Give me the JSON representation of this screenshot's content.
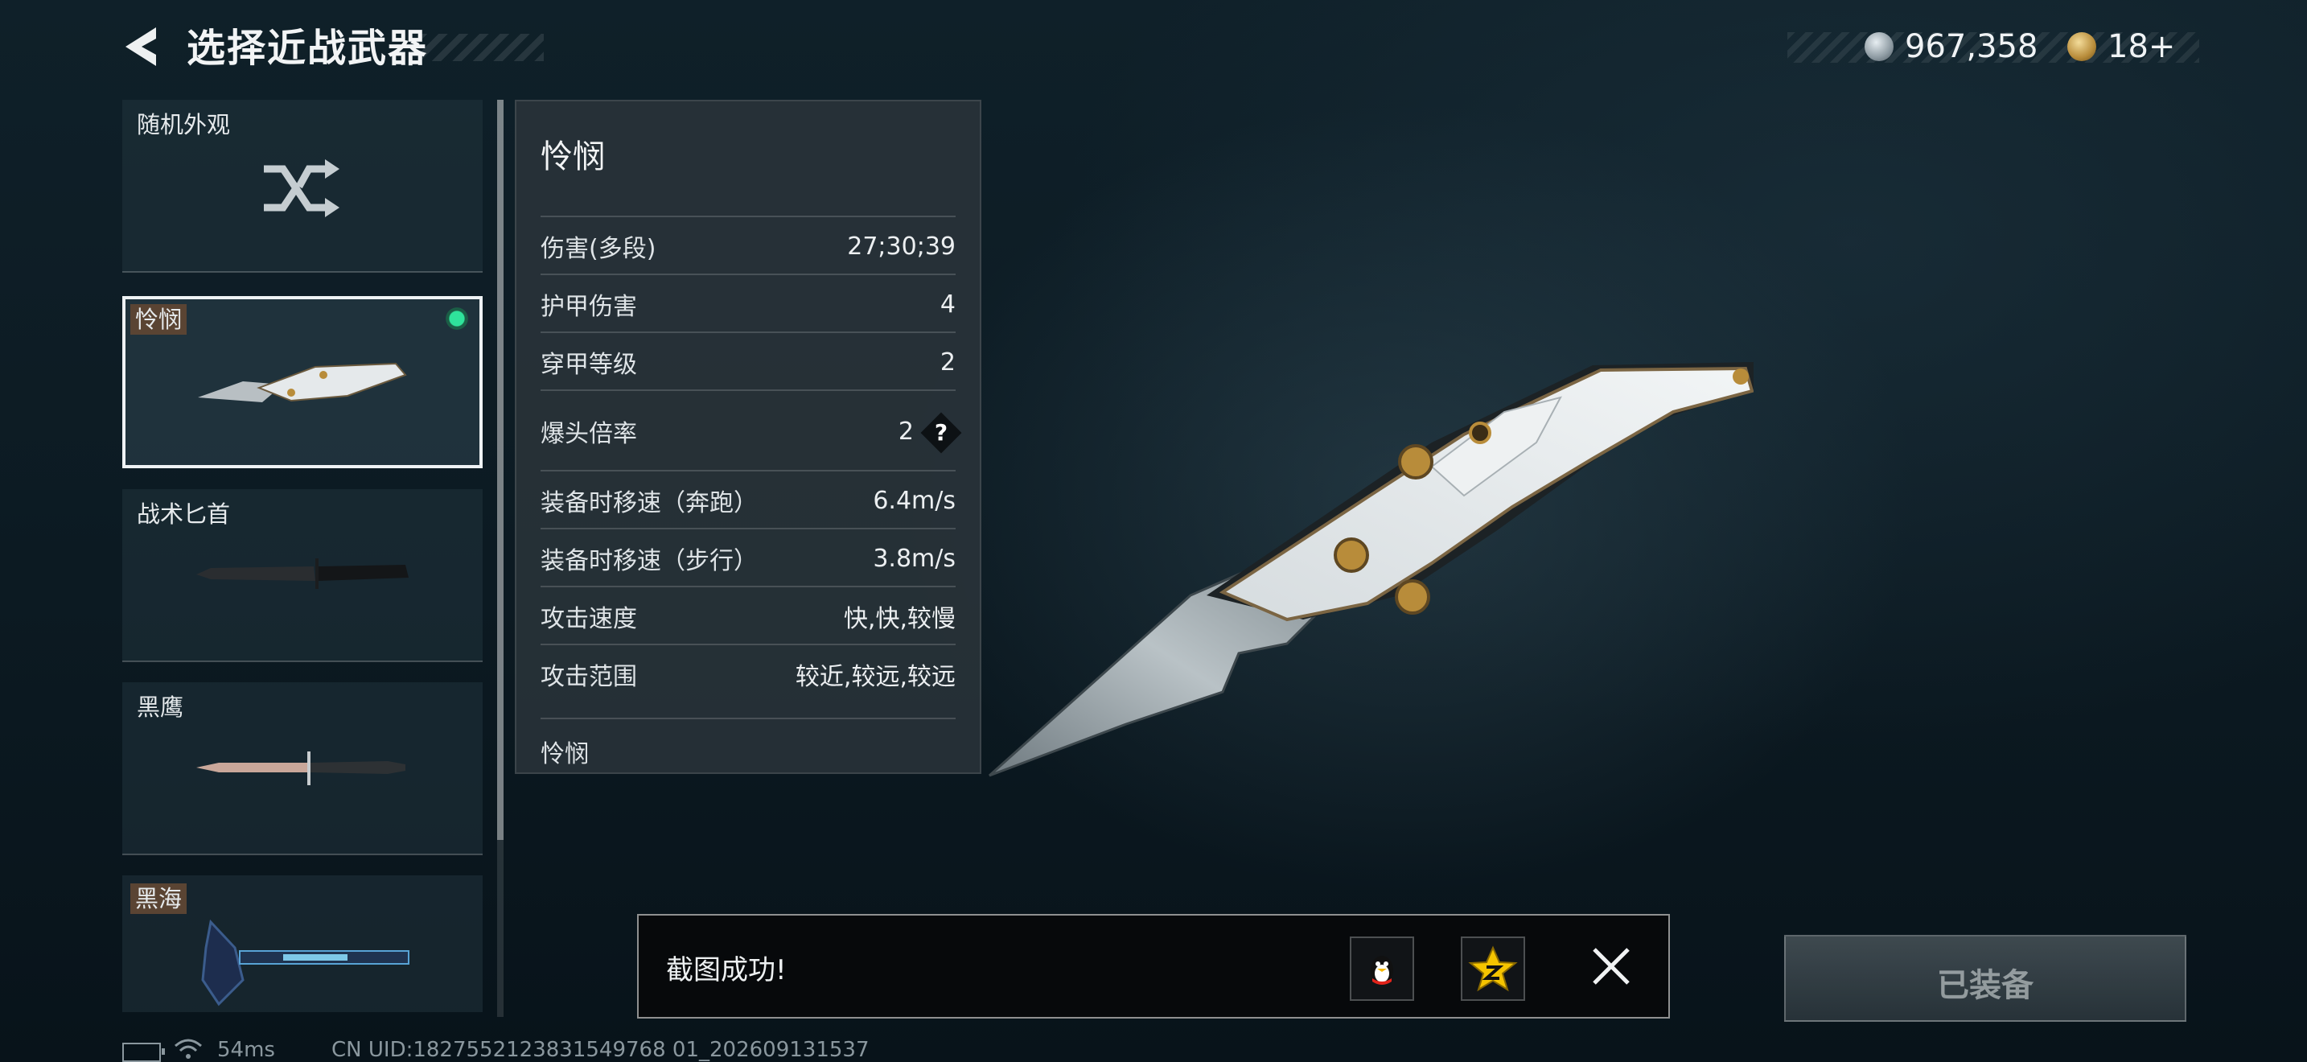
{
  "header": {
    "title": "选择近战武器",
    "currency1": "967,358",
    "currency2": "18+"
  },
  "list": [
    {
      "label": "随机外观",
      "icon": "shuffle-icon"
    },
    {
      "label": "怜悯",
      "selected": true,
      "equipped": true
    },
    {
      "label": "战术匕首"
    },
    {
      "label": "黑鹰"
    },
    {
      "label": "黑海"
    }
  ],
  "panel": {
    "name": "怜悯",
    "stats": [
      {
        "label": "伤害(多段)",
        "value": "27;30;39"
      },
      {
        "label": "护甲伤害",
        "value": "4"
      },
      {
        "label": "穿甲等级",
        "value": "2"
      },
      {
        "label": "爆头倍率",
        "value": "2"
      },
      {
        "label": "装备时移速（奔跑）",
        "value": "6.4m/s"
      },
      {
        "label": "装备时移速（步行）",
        "value": "3.8m/s"
      },
      {
        "label": "攻击速度",
        "value": "快,快,较慢"
      },
      {
        "label": "攻击范围",
        "value": "较近,较远,较远"
      }
    ],
    "help_label": "?",
    "footer": "怜悯"
  },
  "toast": {
    "text": "截图成功!"
  },
  "equip_button": "已装备",
  "status": {
    "ping": "54ms",
    "uid": "CN UID:1827552123831549768 01_202609131537"
  },
  "colors": {
    "equipped_dot": "#2fe39b",
    "tag_bg": "#5a4433",
    "panel_bg": "#283238"
  }
}
